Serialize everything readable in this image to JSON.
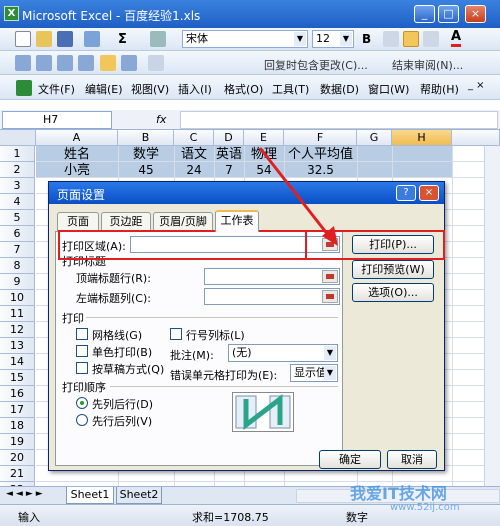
{
  "window": {
    "title": "Microsoft Excel - 百度经验1.xls",
    "app_icon": "X",
    "min": "_",
    "max": "□",
    "close": "×"
  },
  "toolbar": {
    "font_name": "宋体",
    "font_size": "12",
    "bold": "B",
    "sum": "Σ",
    "reply_text": "回复时包含更改(C)...",
    "end_review": "结束审阅(N)..."
  },
  "menu": {
    "items": [
      "文件(F)",
      "编辑(E)",
      "视图(V)",
      "插入(I)",
      "格式(O)",
      "工具(T)",
      "数据(D)",
      "窗口(W)",
      "帮助(H)"
    ]
  },
  "formula": {
    "cell": "H7",
    "fx": "fx"
  },
  "columns": [
    "A",
    "B",
    "C",
    "D",
    "E",
    "F",
    "G",
    "H"
  ],
  "rows": [
    "1",
    "2",
    "3",
    "4",
    "5",
    "6",
    "7",
    "8",
    "9",
    "10",
    "11",
    "12",
    "13",
    "14",
    "15",
    "16",
    "17",
    "18",
    "19",
    "20",
    "21",
    "22"
  ],
  "sheet": {
    "row1": [
      "姓名",
      "数学",
      "语文",
      "英语",
      "物理",
      "个人平均值"
    ],
    "row2": [
      "小亮",
      "45",
      "24",
      "7",
      "54",
      "32.5"
    ]
  },
  "sheet_tabs": [
    "Sheet1",
    "Sheet2"
  ],
  "status": {
    "mode": "输入",
    "sum": "求和=1708.75",
    "numlock": "数字"
  },
  "dialog": {
    "title": "页面设置",
    "help": "?",
    "close": "×",
    "tabs": [
      "页面",
      "页边距",
      "页眉/页脚",
      "工作表"
    ],
    "print_area_label": "打印区域(A):",
    "print_titles_label": "打印标题",
    "top_rows_label": "顶端标题行(R):",
    "left_cols_label": "左端标题列(C):",
    "print_label": "打印",
    "gridlines": "网格线(G)",
    "row_col_headers": "行号列标(L)",
    "mono": "单色打印(B)",
    "draft": "按草稿方式(Q)",
    "comments_label": "批注(M):",
    "comments_value": "(无)",
    "errors_label": "错误单元格打印为(E):",
    "errors_value": "显示值",
    "order_label": "打印顺序",
    "down_then_over": "先列后行(D)",
    "over_then_down": "先行后列(V)",
    "print_btn": "打印(P)...",
    "preview_btn": "打印预览(W)",
    "options_btn": "选项(O)...",
    "ok_btn": "确定",
    "cancel_btn": "取消"
  },
  "watermark": {
    "line1": "我爱IT技术网",
    "line2": "www.52ij.com"
  },
  "colors": {
    "accent": "#e02020",
    "titlebar": "#1f5fc4",
    "highlight": "#b8cce4"
  }
}
